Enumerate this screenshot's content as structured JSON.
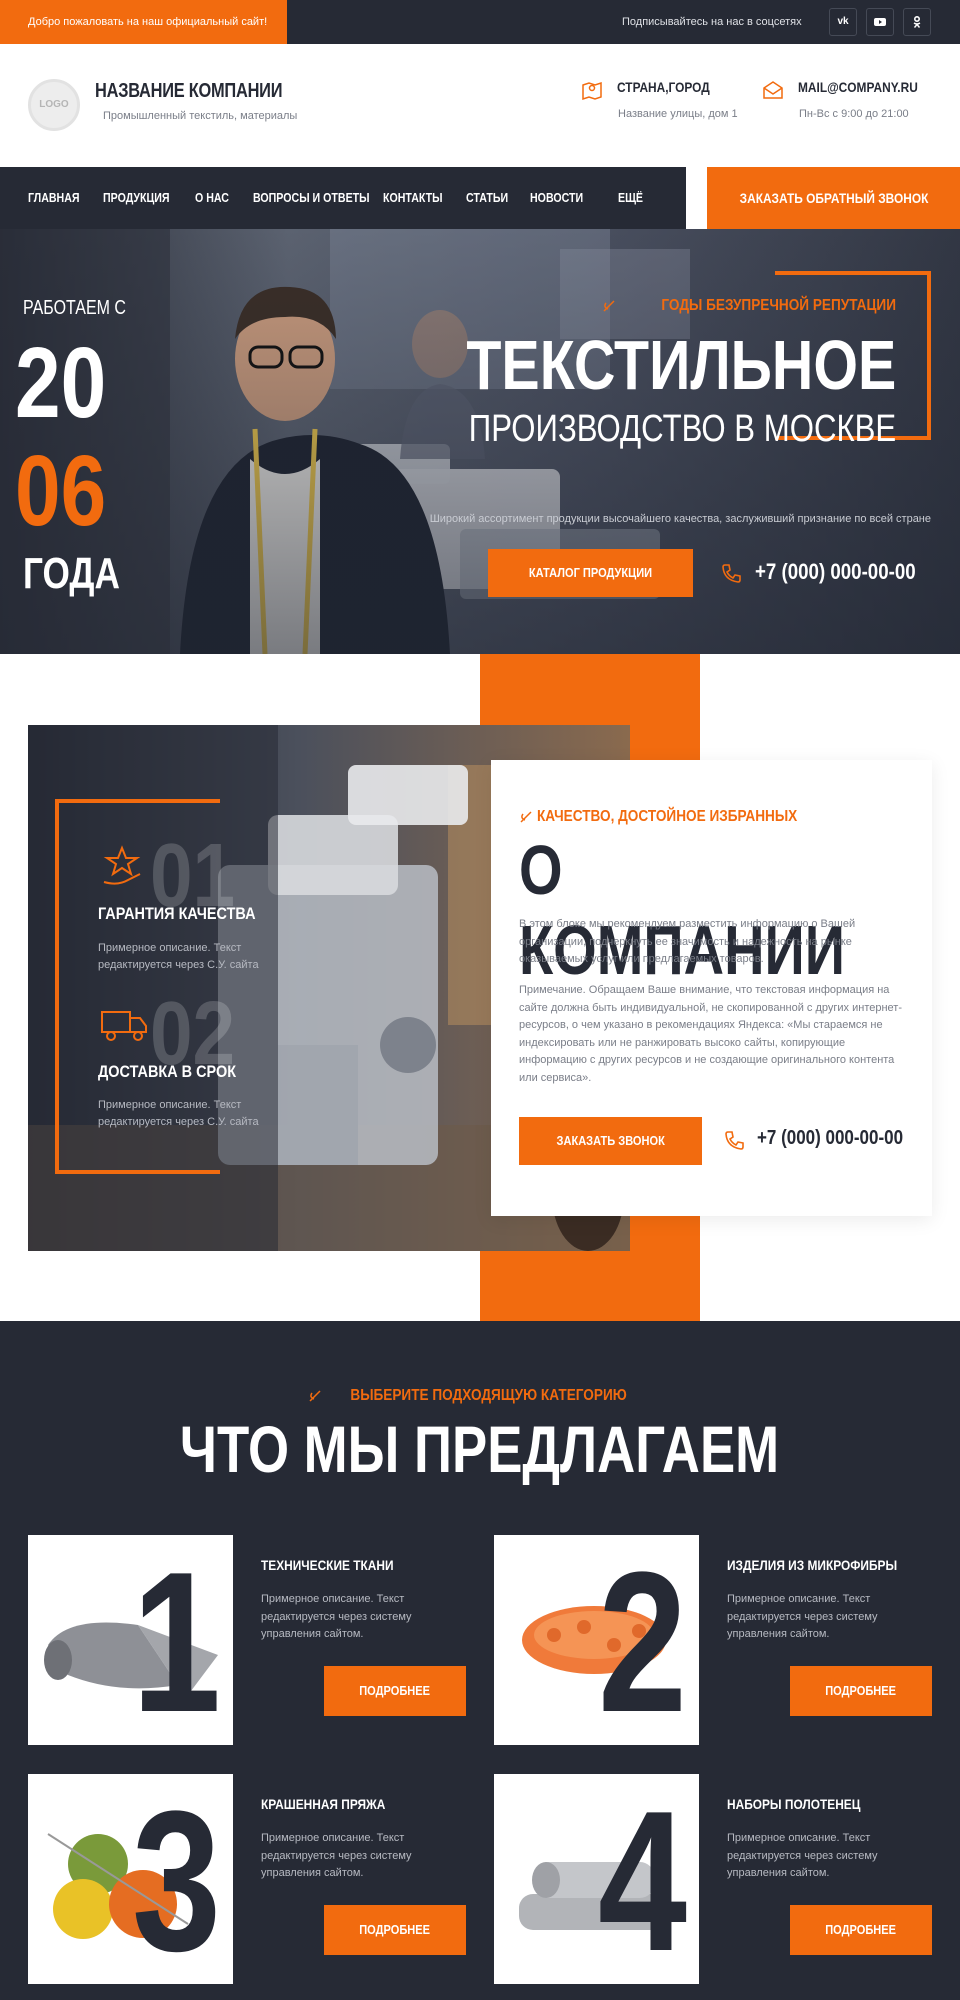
{
  "topbar": {
    "welcome": "Добро пожаловать на наш официальный сайт!",
    "follow": "Подписывайтесь на нас в соцсетях",
    "socials": [
      "vk",
      "yt",
      "ok"
    ]
  },
  "header": {
    "logo": "LOGO",
    "company_name": "НАЗВАНИЕ КОМПАНИИ",
    "tagline": "Промышленный текстиль, материалы",
    "address_title": "СТРАНА,ГОРОД",
    "address_sub": "Название улицы, дом 1",
    "mail_title": "MAIL@COMPANY.RU",
    "mail_sub": "Пн-Вс с 9:00 до 21:00"
  },
  "nav": {
    "items": [
      "ГЛАВНАЯ",
      "ПРОДУКЦИЯ",
      "О НАС",
      "ВОПРОСЫ И ОТВЕТЫ",
      "КОНТАКТЫ",
      "СТАТЬИ",
      "НОВОСТИ",
      "ЕЩЁ"
    ],
    "callback": "ЗАКАЗАТЬ ОБРАТНЫЙ ЗВОНОК"
  },
  "hero": {
    "working_since": "РАБОТАЕМ С",
    "year_part1": "20",
    "year_part2": "06",
    "years_word": "ГОДА",
    "reputation": "ГОДЫ БЕЗУПРЕЧНОЙ РЕПУТАЦИИ",
    "title_line1": "ТЕКСТИЛЬНОЕ",
    "title_line2": "ПРОИЗВОДСТВО В МОСКВЕ",
    "description": "Широкий ассортимент продукции высочайшего качества, заслуживший признание по всей стране",
    "catalog_button": "КАТАЛОГ ПРОДУКЦИИ",
    "phone": "+7 (000) 000-00-00"
  },
  "about": {
    "features": [
      {
        "number": "01",
        "title": "ГАРАНТИЯ КАЧЕСТВА",
        "description": "Примерное описание. Текст редактируется через С.У. сайта"
      },
      {
        "number": "02",
        "title": "ДОСТАВКА В СРОК",
        "description": "Примерное описание. Текст редактируется через С.У. сайта"
      }
    ],
    "subtitle": "КАЧЕСТВО, ДОСТОЙНОЕ ИЗБРАННЫХ",
    "title": "О КОМПАНИИ",
    "text1": "В этом блоке мы рекомендуем разместить информацию о Вашей организации, подчеркнуть ее значимость и надежность на рынке оказываемых услуг или предлагаемых товаров.",
    "text2": "Примечание. Обращаем Ваше внимание, что текстовая информация на сайте должна быть индивидуальной, не скопированной с других интернет-ресурсов, о чем указано в рекомендациях Яндекса: «Мы стараемся не индексировать или не ранжировать высоко сайты, копирующие информацию с других ресурсов и не создающие оригинального контента или сервиса».",
    "button": "ЗАКАЗАТЬ ЗВОНОК",
    "phone": "+7 (000) 000-00-00"
  },
  "offers": {
    "subtitle": "ВЫБЕРИТЕ ПОДХОДЯЩУЮ КАТЕГОРИЮ",
    "title": "ЧТО МЫ ПРЕДЛАГАЕМ",
    "cards": [
      {
        "number": "1",
        "title": "ТЕХНИЧЕСКИЕ ТКАНИ",
        "description": "Примерное описание. Текст редактируется через систему управления сайтом.",
        "button": "ПОДРОБНЕЕ"
      },
      {
        "number": "2",
        "title": "ИЗДЕЛИЯ ИЗ МИКРОФИБРЫ",
        "description": "Примерное описание. Текст редактируется через систему управления сайтом.",
        "button": "ПОДРОБНЕЕ"
      },
      {
        "number": "3",
        "title": "КРАШЕННАЯ ПРЯЖА",
        "description": "Примерное описание. Текст редактируется через систему управления сайтом.",
        "button": "ПОДРОБНЕЕ"
      },
      {
        "number": "4",
        "title": "НАБОРЫ ПОЛОТЕНЕЦ",
        "description": "Примерное описание. Текст редактируется через систему управления сайтом.",
        "button": "ПОДРОБНЕЕ"
      }
    ]
  },
  "colors": {
    "accent": "#f26b0f",
    "dark": "#262a35",
    "white": "#ffffff"
  }
}
